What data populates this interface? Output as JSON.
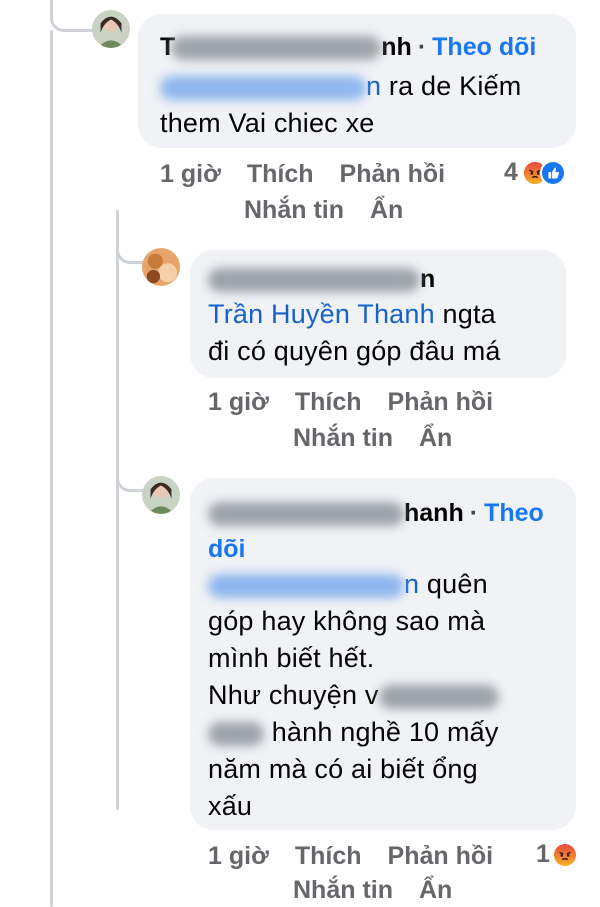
{
  "comment1": {
    "name_visible": "T",
    "name_end": "nh",
    "follow": "Theo dõi",
    "mention_end": "n",
    "text_line1": " ra de Kiếm",
    "text_line2": "them Vai chiec xe",
    "time": "1 giờ",
    "like": "Thích",
    "reply": "Phản hồi",
    "message": "Nhắn tin",
    "hide": "Ẩn",
    "reaction_count": "4"
  },
  "comment2": {
    "name_end": "n",
    "mention": "Trần Huyền Thanh",
    "text_line1": " ngta",
    "text_line2": "đi có quyên góp đâu má",
    "time": "1 giờ",
    "like": "Thích",
    "reply": "Phản hồi",
    "message": "Nhắn tin",
    "hide": "Ẩn"
  },
  "comment3": {
    "name_end": "hanh",
    "follow_part1": "Theo",
    "follow_part2": "dõi",
    "mention_end": "n",
    "line1": " quên",
    "line2": "góp hay không sao mà",
    "line3": "mình biết hết.",
    "line4": "Như chuyện v",
    "line5": " hành nghề 10 mấy",
    "line6": "năm mà có ai biết ổng",
    "line7": "xấu",
    "time": "1 giờ",
    "like": "Thích",
    "reply": "Phản hồi",
    "message": "Nhắn tin",
    "hide": "Ẩn",
    "reaction_count": "1"
  },
  "colors": {
    "follow": "#1877f2",
    "mention": "#1563c7",
    "bubble": "#f0f2f5",
    "meta": "#65676b"
  }
}
